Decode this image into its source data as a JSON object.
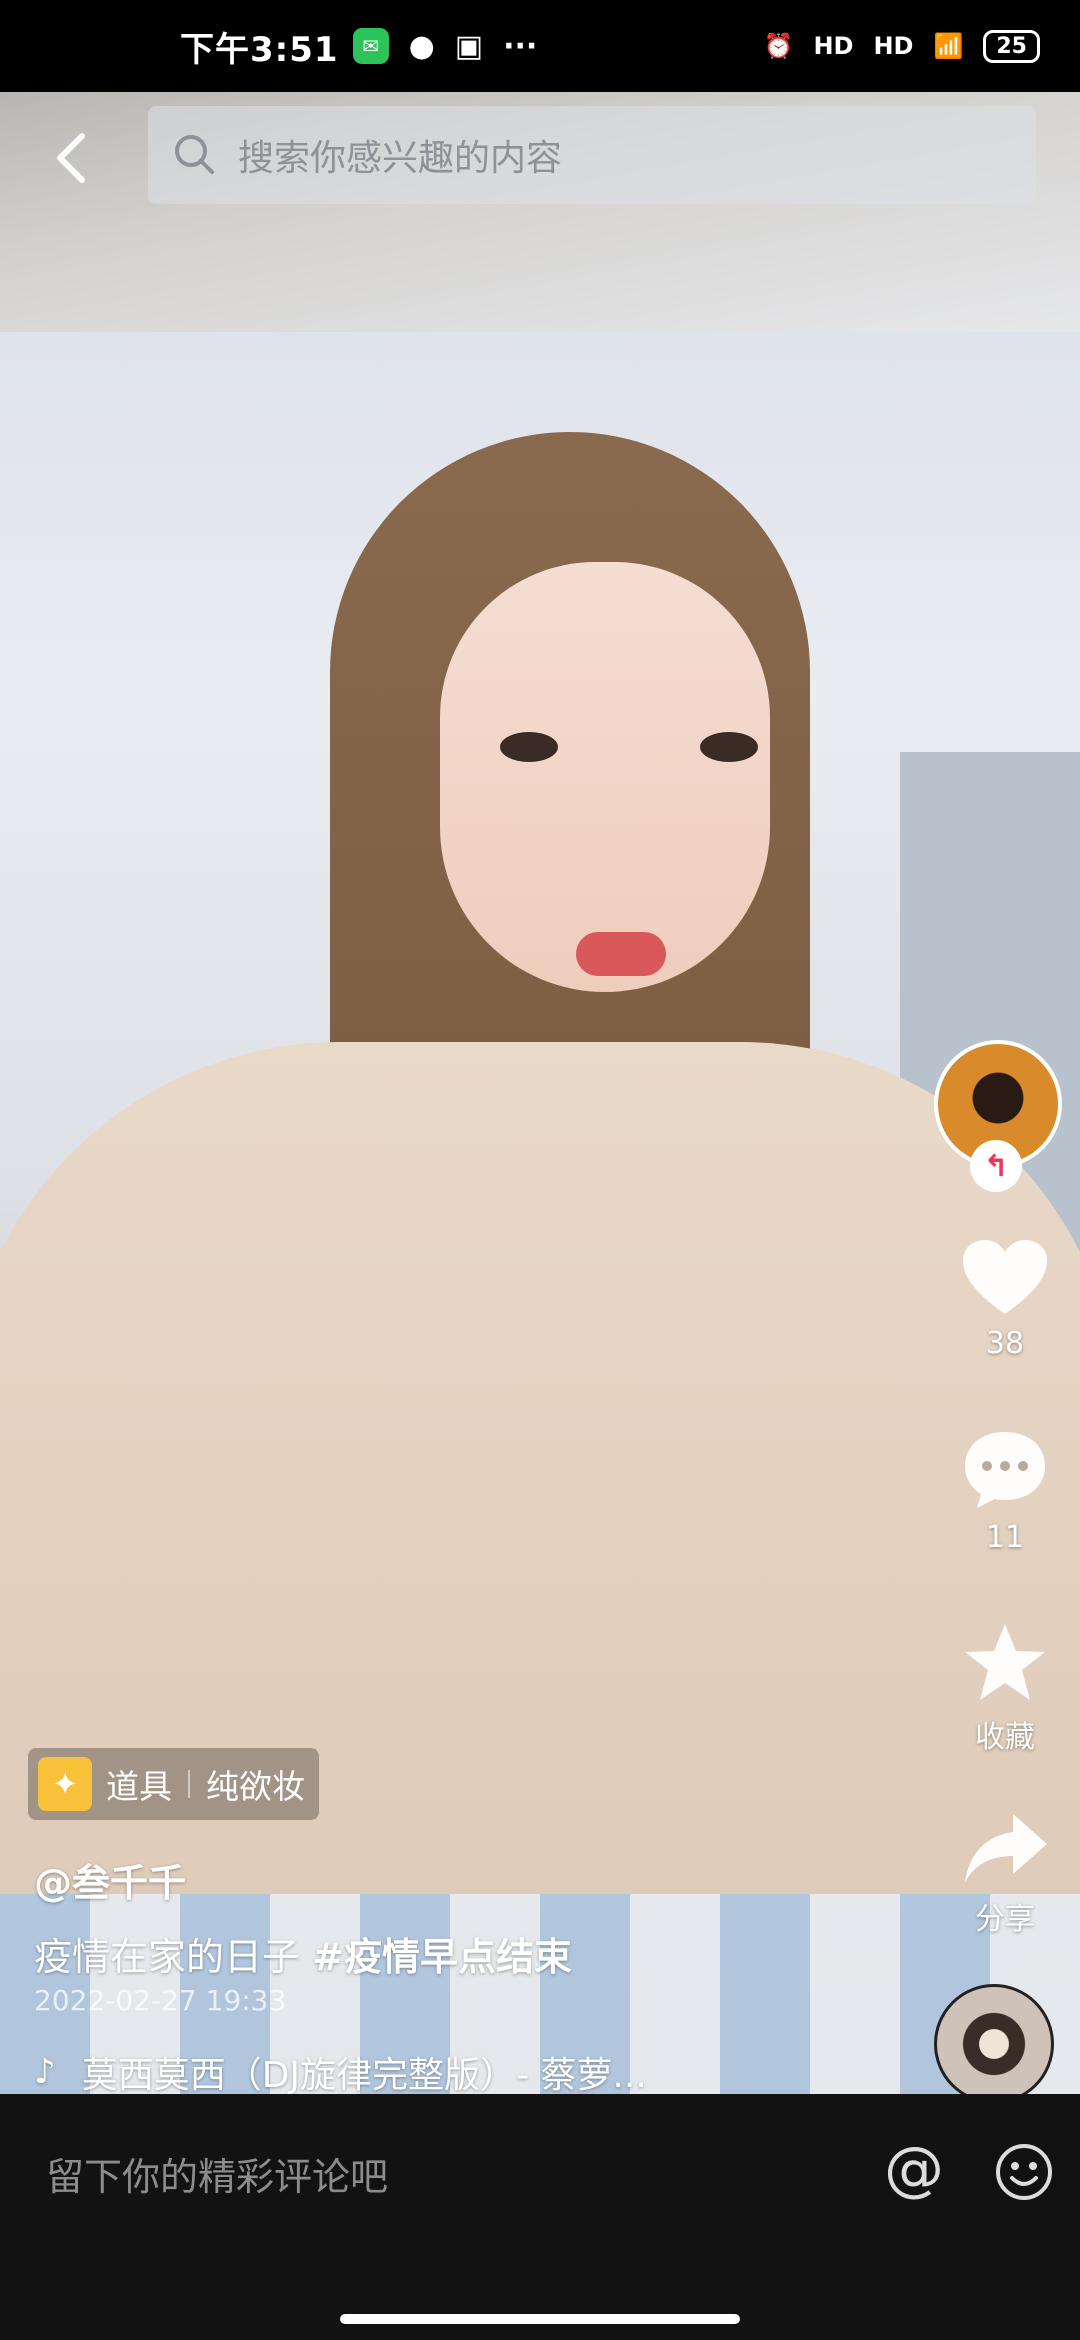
{
  "status_bar": {
    "time": "下午3:51",
    "more": "···",
    "signal1": "HD",
    "signal2": "HD",
    "battery": "25"
  },
  "search": {
    "placeholder": "搜索你感兴趣的内容",
    "back_icon": "chevron-left-icon",
    "search_icon": "magnifier-icon"
  },
  "rail": {
    "likes": "38",
    "comments": "11",
    "favorite_label": "收藏",
    "share_label": "分享"
  },
  "prop": {
    "label": "道具",
    "name": "纯欲妆"
  },
  "post": {
    "author": "@叁千千",
    "description": "疫情在家的日子",
    "hashtag": "#疫情早点结束",
    "date": "2022-02-27 19:33",
    "music": "莫西莫西（DJ旋律完整版）- 蔡萝..."
  },
  "comment_bar": {
    "placeholder": "留下你的精彩评论吧",
    "at_symbol": "@"
  },
  "colors": {
    "like_heart": "#ffffff",
    "follow_accent": "#f0345a",
    "prop_icon_bg": "#f7c23a"
  }
}
